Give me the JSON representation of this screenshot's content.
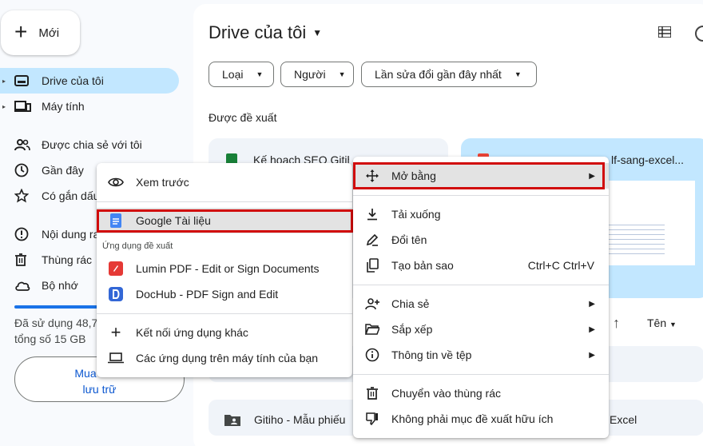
{
  "sidebar": {
    "new_label": "Mới",
    "items": [
      {
        "label": "Drive của tôi",
        "icon": "drive-icon",
        "caret": "▸"
      },
      {
        "label": "Máy tính",
        "icon": "computer-icon",
        "caret": "▸"
      },
      {
        "label": "Được chia sẻ với tôi",
        "icon": "shared-icon"
      },
      {
        "label": "Gần đây",
        "icon": "clock-icon"
      },
      {
        "label": "Có gắn dấu",
        "icon": "star-icon"
      },
      {
        "label": "Nội dung ra",
        "icon": "spam-icon"
      },
      {
        "label": "Thùng rác",
        "icon": "trash-icon"
      },
      {
        "label": "Bộ nhớ",
        "icon": "cloud-icon"
      }
    ],
    "storage_line1": "Đã sử dụng 48,7",
    "storage_line2": "tổng số 15 GB",
    "storage_fraction": 0.5,
    "buy_line1": "Mua thêm",
    "buy_line2": "lưu trữ"
  },
  "main": {
    "title": "Drive của tôi",
    "chips": [
      "Loại",
      "Người",
      "Lần sửa đổi gần đây nhất"
    ],
    "suggested_label": "Được đề xuất",
    "card1_title": "Kế hoạch SEO Gitih",
    "card2_title": "lf-sang-excel...",
    "sort_label": "Tên",
    "row2_text": "Gitiho - Mẫu phiếu",
    "row2_tail": "Excel"
  },
  "menu_left": {
    "preview": "Xem trước",
    "google_docs": "Google Tài liệu",
    "suggested_apps": "Ứng dụng đề xuất",
    "lumin": "Lumin PDF - Edit or Sign Documents",
    "dochub": "DocHub - PDF Sign and Edit",
    "connect_more": "Kết nối ứng dụng khác",
    "desktop_apps": "Các ứng dụng trên máy tính của bạn"
  },
  "menu_right": {
    "open_with": "Mở bằng",
    "download": "Tải xuống",
    "rename": "Đổi tên",
    "make_copy": "Tạo bản sao",
    "make_copy_shortcut": "Ctrl+C Ctrl+V",
    "share": "Chia sẻ",
    "organize": "Sắp xếp",
    "file_info": "Thông tin về tệp",
    "move_to_trash": "Chuyển vào thùng rác",
    "not_helpful": "Không phải mục đề xuất hữu ích"
  },
  "colors": {
    "active_nav": "#c2e7ff",
    "highlight_box": "#d10b0b",
    "sheets_green": "#188038",
    "pdf_red": "#ea4335",
    "docs_blue": "#4285f4"
  }
}
